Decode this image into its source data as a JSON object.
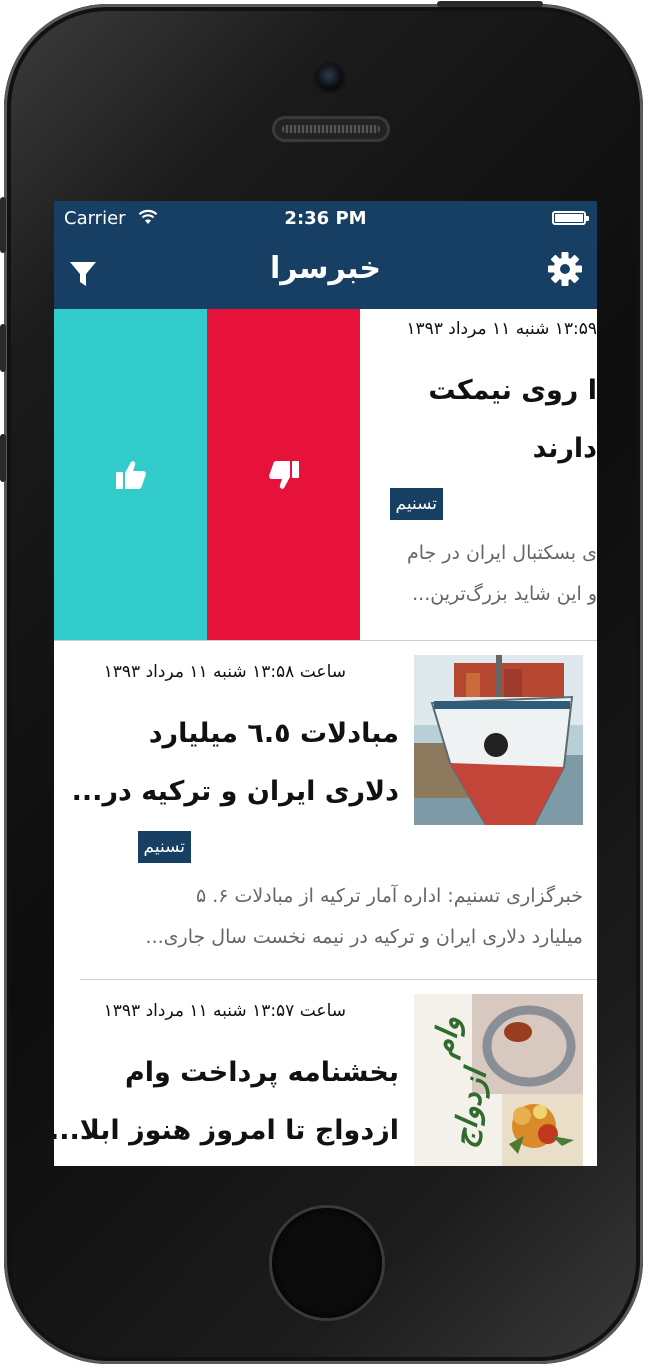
{
  "status_bar": {
    "carrier": "Carrier",
    "time": "2:36 PM"
  },
  "nav": {
    "title": "خبرسرا",
    "filter_icon": "filter-icon",
    "settings_icon": "gear-icon"
  },
  "colors": {
    "primary": "#173f63",
    "like": "#33cccc",
    "dislike": "#e6123a"
  },
  "swipe_actions": {
    "like_icon": "thumbs-up-icon",
    "dislike_icon": "thumbs-down-icon"
  },
  "items": [
    {
      "date": "۱۳:۵۹ شنبه ۱۱ مرداد ۱۳۹۳",
      "title_line1": "ا روی نیمکت",
      "title_line2": "دارند",
      "source": "تسنیم",
      "summary_line1": "ی بسکتبال ایران در جام",
      "summary_line2": "و این شاید بزرگ‌ترین..."
    },
    {
      "date": "ساعت ۱۳:۵۸ شنبه ۱۱ مرداد ۱۳۹۳",
      "title_line1": "مبادلات ٦.٥ میلیارد",
      "title_line2": "دلاری ایران و ترکیه در...",
      "source": "تسنیم",
      "summary_line1": "خبرگزاری تسنیم: اداره آمار ترکیه از مبادلات ۶. ۵",
      "summary_line2": "میلیارد دلاری ایران و ترکیه در نیمه نخست سال جاری...",
      "image": "container-ship-image"
    },
    {
      "date": "ساعت ۱۳:۵۷ شنبه ۱۱ مرداد ۱۳۹۳",
      "title_line1": "بخشنامه پرداخت وام",
      "title_line2": "ازدواج تا امروز هنوز ابلا...",
      "image": "wedding-loan-image",
      "image_text_1": "وام",
      "image_text_2": "ازدواج"
    }
  ]
}
